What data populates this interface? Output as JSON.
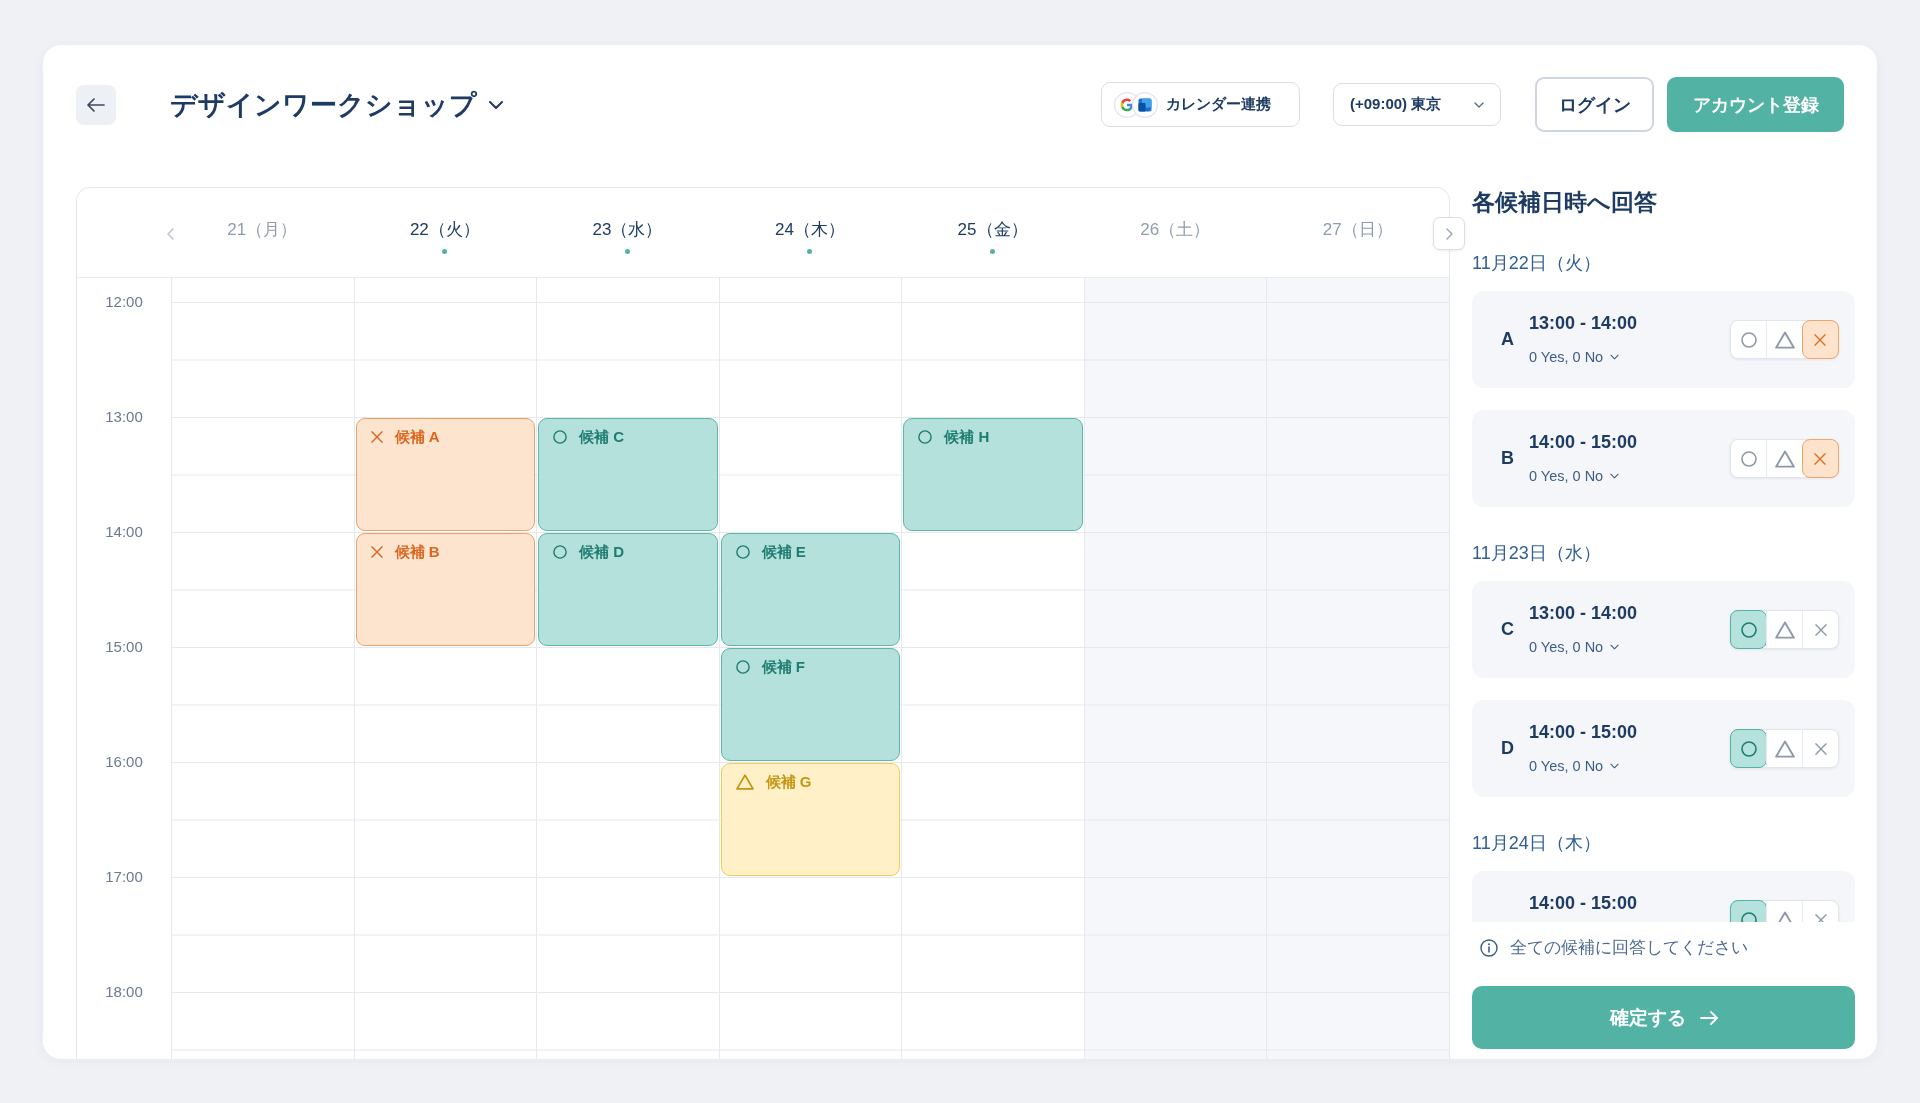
{
  "header": {
    "title": "デザインワークショップ",
    "calendar_link": "カレンダー連携",
    "timezone": "(+09:00) 東京",
    "login": "ログイン",
    "signup": "アカウント登録"
  },
  "calendar": {
    "days": [
      {
        "label": "21（月）",
        "muted": true,
        "has_candidates": false,
        "color": "#ffffff"
      },
      {
        "label": "22（火）",
        "muted": false,
        "has_candidates": true,
        "color": "#ffffff"
      },
      {
        "label": "23（水）",
        "muted": false,
        "has_candidates": true,
        "color": "#ffffff"
      },
      {
        "label": "24（木）",
        "muted": false,
        "has_candidates": true,
        "color": "#ffffff"
      },
      {
        "label": "25（金）",
        "muted": false,
        "has_candidates": true,
        "color": "#ffffff"
      },
      {
        "label": "26（土）",
        "muted": true,
        "has_candidates": false,
        "color": "#f5f7fb"
      },
      {
        "label": "27（日）",
        "muted": true,
        "has_candidates": false,
        "color": "#f5f7fb"
      }
    ],
    "rows": [
      {
        "time": "12:00",
        "cells": [
          null,
          null,
          null,
          null,
          null,
          null,
          null
        ]
      },
      {
        "time": "13:00",
        "cells": [
          null,
          {
            "label": "候補 A",
            "kind": "no"
          },
          {
            "label": "候補 C",
            "kind": "yes"
          },
          null,
          {
            "label": "候補 H",
            "kind": "yes"
          },
          null,
          null
        ]
      },
      {
        "time": "14:00",
        "cells": [
          null,
          {
            "label": "候補 B",
            "kind": "no"
          },
          {
            "label": "候補 D",
            "kind": "yes"
          },
          {
            "label": "候補 E",
            "kind": "yes"
          },
          null,
          null,
          null
        ]
      },
      {
        "time": "15:00",
        "cells": [
          null,
          null,
          null,
          {
            "label": "候補 F",
            "kind": "yes"
          },
          null,
          null,
          null
        ]
      },
      {
        "time": "16:00",
        "cells": [
          null,
          null,
          null,
          {
            "label": "候補 G",
            "kind": "maybe"
          },
          null,
          null,
          null
        ]
      },
      {
        "time": "17:00",
        "cells": [
          null,
          null,
          null,
          null,
          null,
          null,
          null
        ]
      },
      {
        "time": "18:00",
        "cells": [
          null,
          null,
          null,
          null,
          null,
          null,
          null
        ]
      }
    ]
  },
  "answer_panel": {
    "title": "各候補日時へ回答",
    "groups": [
      {
        "date": "11月22日（火）",
        "candidates": [
          {
            "letter": "A",
            "time": "13:00 - 14:00",
            "votes": "0 Yes, 0 No",
            "options": [
              {
                "kind": "yes",
                "selected": false
              },
              {
                "kind": "maybe",
                "selected": false
              },
              {
                "kind": "no",
                "selected": true
              }
            ]
          },
          {
            "letter": "B",
            "time": "14:00 - 15:00",
            "votes": "0 Yes, 0 No",
            "options": [
              {
                "kind": "yes",
                "selected": false
              },
              {
                "kind": "maybe",
                "selected": false
              },
              {
                "kind": "no",
                "selected": true
              }
            ]
          }
        ]
      },
      {
        "date": "11月23日（水）",
        "candidates": [
          {
            "letter": "C",
            "time": "13:00 - 14:00",
            "votes": "0 Yes, 0 No",
            "options": [
              {
                "kind": "yes",
                "selected": true
              },
              {
                "kind": "maybe",
                "selected": false
              },
              {
                "kind": "no",
                "selected": false
              }
            ]
          },
          {
            "letter": "D",
            "time": "14:00 - 15:00",
            "votes": "0 Yes, 0 No",
            "options": [
              {
                "kind": "yes",
                "selected": true
              },
              {
                "kind": "maybe",
                "selected": false
              },
              {
                "kind": "no",
                "selected": false
              }
            ]
          }
        ]
      },
      {
        "date": "11月24日（木）",
        "candidates": [
          {
            "time": "14:00 - 15:00",
            "options": [
              {
                "kind": "yes",
                "selected": true
              },
              {
                "kind": "maybe",
                "selected": false
              },
              {
                "kind": "no",
                "selected": false
              }
            ]
          }
        ]
      }
    ],
    "note": "全ての候補に回答してください",
    "confirm": "確定する"
  }
}
